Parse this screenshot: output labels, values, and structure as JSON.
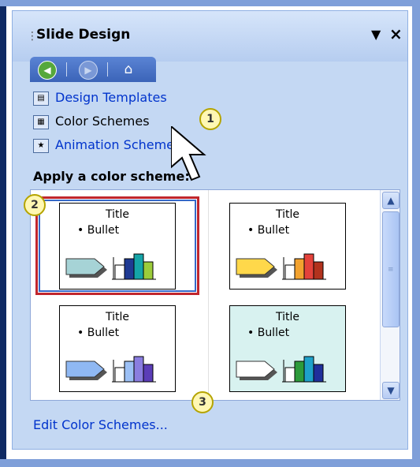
{
  "pane": {
    "title": "Slide Design",
    "menu_glyph": "▼",
    "close_glyph": "×"
  },
  "nav": {
    "back_icon": "back-arrow-icon",
    "forward_icon": "forward-arrow-icon",
    "home_icon": "home-icon"
  },
  "links": {
    "design_templates": "Design Templates",
    "color_schemes": "Color Schemes",
    "animation_schemes": "Animation Schemes"
  },
  "section_label": "Apply a color scheme:",
  "thumbnails": [
    {
      "title": "Title",
      "bullet": "• Bullet",
      "background": "#ffffff",
      "arrow": "#a6d3d6",
      "bars": [
        "#1f3a93",
        "#15a4a8",
        "#9ccc3a"
      ]
    },
    {
      "title": "Title",
      "bullet": "• Bullet",
      "background": "#ffffff",
      "arrow": "#ffd84a",
      "bars": [
        "#f2a22f",
        "#e4423b",
        "#b2321d"
      ]
    },
    {
      "title": "Title",
      "bullet": "• Bullet",
      "background": "#ffffff",
      "arrow": "#8fb8f3",
      "bars": [
        "#9cc0f5",
        "#8a7de0",
        "#5b3db7"
      ]
    },
    {
      "title": "Title",
      "bullet": "• Bullet",
      "background": "#d8f2f0",
      "arrow": "#ffffff",
      "bars": [
        "#2d9b3b",
        "#1ea1c9",
        "#1f2f9b"
      ]
    }
  ],
  "edit_link": "Edit Color Schemes...",
  "callouts": [
    "1",
    "2",
    "3"
  ],
  "colors": {
    "pane_bg": "#c4d8f3",
    "nav_bar": "#4a72c6",
    "link_blue": "#0033cc",
    "selection_red": "#c0262d",
    "selection_blue": "#3569c8"
  }
}
